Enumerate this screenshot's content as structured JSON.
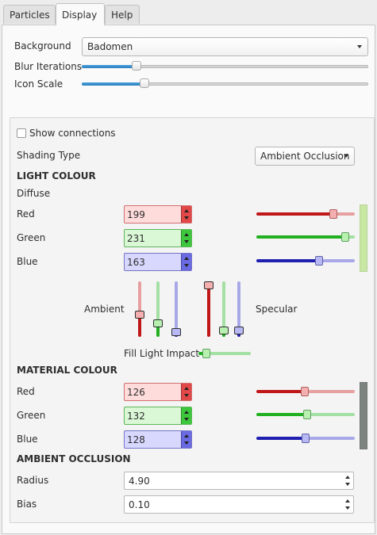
{
  "tabs": [
    {
      "label": "Particles"
    },
    {
      "label": "Display"
    },
    {
      "label": "Help"
    }
  ],
  "display": {
    "background_label": "Background",
    "background_value": "Badomen",
    "blur_label": "Blur Iterations",
    "blur_level": 0.19,
    "icon_scale_label": "Icon Scale",
    "icon_scale_level": 0.22
  },
  "options": {
    "show_connections_label": "Show connections",
    "show_connections_checked": false,
    "shading_type_label": "Shading Type",
    "shading_type_value": "Ambient Occlusion"
  },
  "light_colour": {
    "header": "LIGHT COLOUR",
    "diffuse_label": "Diffuse",
    "red_label": "Red",
    "red_value": "199",
    "green_label": "Green",
    "green_value": "231",
    "blue_label": "Blue",
    "blue_value": "163",
    "swatch_color": "#c7e7a3",
    "ambient_label": "Ambient",
    "ambient_levels": {
      "red": 0.4,
      "green": 0.25,
      "blue": 0.08
    },
    "specular_label": "Specular",
    "specular_levels": {
      "red": 1.0,
      "green": 0.12,
      "blue": 0.12
    },
    "fill_light_label": "Fill Light Impact",
    "fill_light_level": 0.15
  },
  "material_colour": {
    "header": "MATERIAL COLOUR",
    "red_label": "Red",
    "red_value": "126",
    "green_label": "Green",
    "green_value": "132",
    "blue_label": "Blue",
    "blue_value": "128",
    "swatch_color": "#7e8480"
  },
  "ambient_occlusion": {
    "header": "AMBIENT OCCLUSION",
    "radius_label": "Radius",
    "radius_value": "4.90",
    "bias_label": "Bias",
    "bias_value": "0.10"
  },
  "colors": {
    "accent": "#2b7fc0",
    "red": "#c01818",
    "green": "#20b020",
    "blue": "#2020b0"
  }
}
